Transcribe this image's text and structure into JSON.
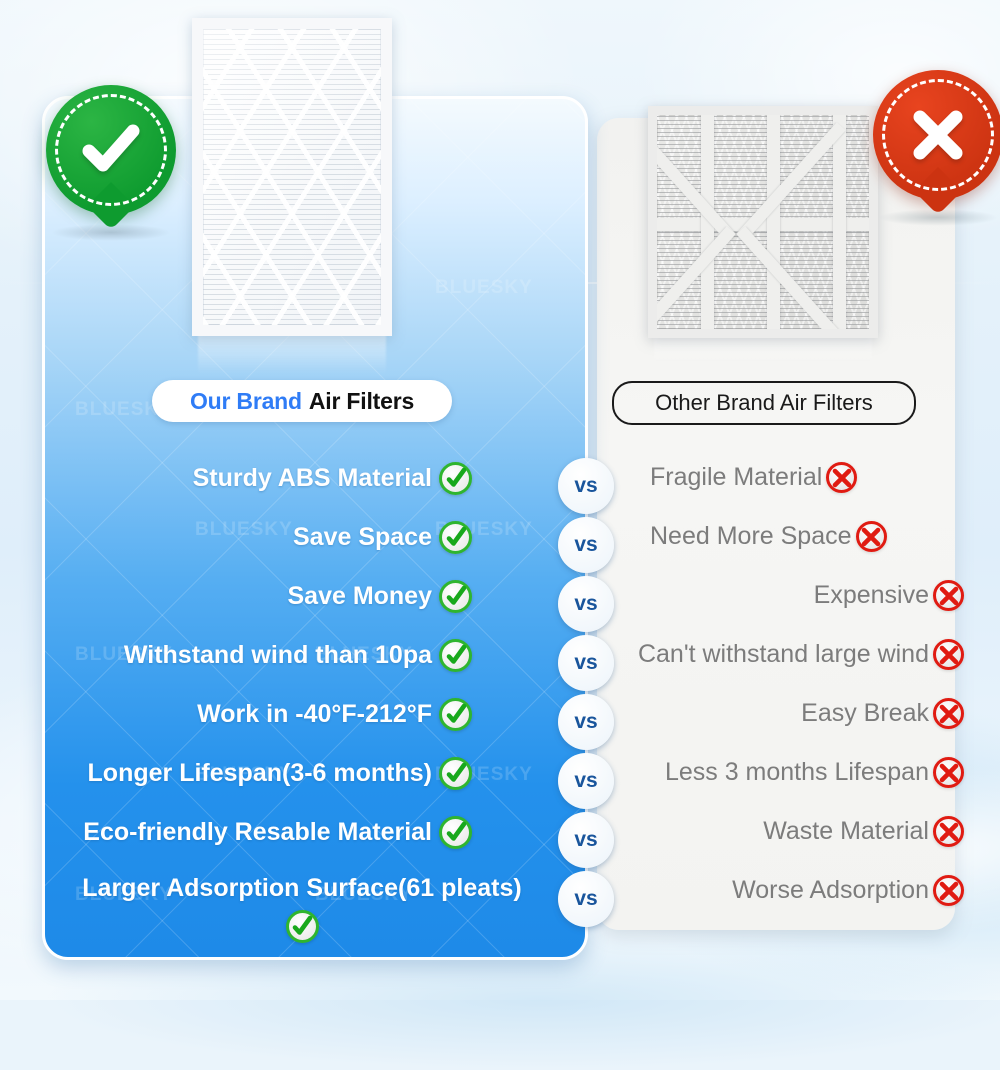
{
  "brand_watermark": "BLUESKY",
  "colors": {
    "panel_blue_top": "#dcefff",
    "panel_blue_bottom": "#1e8ae8",
    "panel_grey": "#f4f4f2",
    "good_green": "#11a232",
    "bad_red": "#d6381a",
    "vs_blue": "#19559c",
    "our_brand_blue": "#2f7cf6"
  },
  "badges": {
    "good": {
      "icon": "check-icon",
      "label": "check"
    },
    "bad": {
      "icon": "cross-icon",
      "label": "cross"
    }
  },
  "headers": {
    "left_highlight": "Our Brand",
    "left_rest": "Air Filters",
    "right": "Other Brand Air Filters"
  },
  "vs_label": "vs",
  "rows": [
    {
      "left": "Sturdy ABS Material",
      "right": "Fragile Material",
      "wrap": false,
      "right_shift": false
    },
    {
      "left": "Save Space",
      "right": "Need More Space",
      "wrap": false,
      "right_shift": false
    },
    {
      "left": "Save Money",
      "right": "Expensive",
      "wrap": false,
      "right_shift": true
    },
    {
      "left": "Withstand wind than 10pa",
      "right": "Can't withstand large wind",
      "wrap": false,
      "right_shift": true
    },
    {
      "left": "Work in -40°F-212°F",
      "right": "Easy Break",
      "wrap": false,
      "right_shift": true
    },
    {
      "left": "Longer Lifespan(3-6 months)",
      "right": "Less 3 months Lifespan",
      "wrap": false,
      "right_shift": true
    },
    {
      "left": "Eco-friendly Resable Material",
      "right": "Waste Material",
      "wrap": false,
      "right_shift": true
    },
    {
      "left": "Larger Adsorption Surface(61 pleats)",
      "right": "Worse Adsorption",
      "wrap": true,
      "right_shift": true
    }
  ],
  "products": {
    "good_filter": "our-brand-air-filter-photo",
    "bad_filter": "other-brand-air-filter-photo"
  }
}
